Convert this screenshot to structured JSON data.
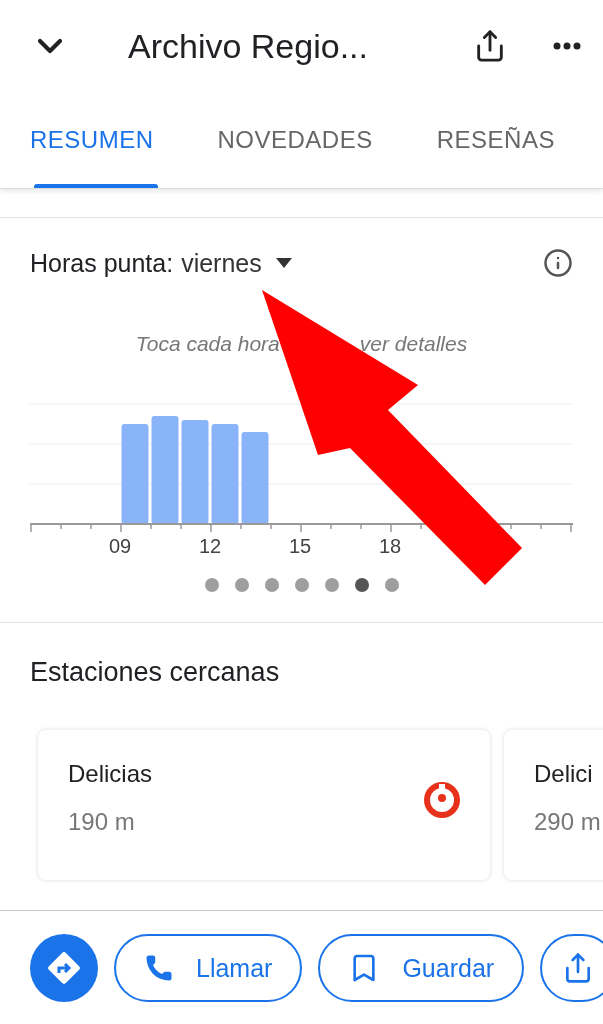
{
  "header": {
    "title": "Archivo Regio..."
  },
  "tabs": [
    {
      "label": "RESUMEN",
      "selected": true
    },
    {
      "label": "NOVEDADES",
      "selected": false
    },
    {
      "label": "RESEÑAS",
      "selected": false
    }
  ],
  "popular_times": {
    "label": "Horas punta:",
    "day": "viernes",
    "hint_parts": [
      "Toca cada hora",
      "ver detalles"
    ],
    "x_labels": [
      "09",
      "12",
      "15",
      "18"
    ],
    "pages": [
      {
        "selected": false
      },
      {
        "selected": false
      },
      {
        "selected": false
      },
      {
        "selected": false
      },
      {
        "selected": false
      },
      {
        "selected": true
      },
      {
        "selected": false
      }
    ]
  },
  "stations": {
    "title": "Estaciones cercanas",
    "items": [
      {
        "name": "Delicias",
        "distance": "190 m",
        "line_icon": true
      },
      {
        "name": "Delici",
        "distance": "290 m"
      }
    ]
  },
  "actions": [
    {
      "kind": "directions"
    },
    {
      "kind": "call",
      "label": "Llamar"
    },
    {
      "kind": "save",
      "label": "Guardar"
    },
    {
      "kind": "share"
    }
  ]
}
